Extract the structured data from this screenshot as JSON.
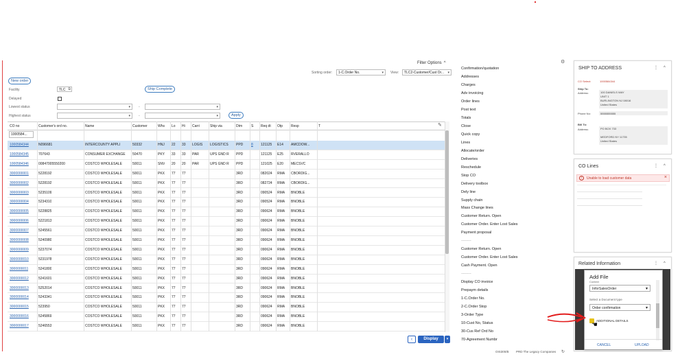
{
  "header": {
    "filter_options": "Filter Options",
    "sorting_order_label": "Sorting order:",
    "sorting_order_value": "1-C.Order No.",
    "view_label": "View:",
    "view_value": "TLC2-Customer/Cust Or..."
  },
  "filters": {
    "new_order": "New order",
    "facility_label": "Facility",
    "facility_value": "TLC",
    "ship_complete": "Ship Complete",
    "delayed_label": "Delayed",
    "lowest_status_label": "Lowest status",
    "highest_status_label": "Highest status",
    "dash": "-",
    "apply": "Apply",
    "co_filter_value": "1000584..."
  },
  "table": {
    "columns": [
      "CO no",
      "Customer's ord no.",
      "Name",
      "Customer",
      "Whs",
      "Lo",
      "Hi",
      "Carri",
      "Ship via",
      "Dtm",
      "S",
      "Req dt",
      "Otp",
      "Resp",
      "T"
    ],
    "rows": [
      [
        "1000584344",
        "N096681",
        "INTERCOUNTY APPLI",
        "50332",
        "HNJ",
        "22",
        "33",
        "LOGIS",
        "LOGISTICS",
        "PPD",
        "8",
        "121125",
        "E14",
        "AMCDOW..."
      ],
      [
        "1000584345",
        "707643",
        "CONSUMER EXCHANGE",
        "50470",
        "PKY",
        "33",
        "33",
        "PAR",
        "UPS GND R",
        "PPD",
        "",
        "121125",
        "E25",
        "RVERALLO"
      ],
      [
        "1000584346",
        "00847005550200",
        "COSTCO WHOLESALE",
        "50011",
        "SNV",
        "20",
        "20",
        "PAR",
        "UPS GND R",
        "PPD",
        "",
        "121025",
        "E20",
        "MECSVC"
      ],
      [
        "3000000001",
        "5228192",
        "COSTCO WHOLESALE",
        "50011",
        "PKX",
        "77",
        "77",
        "",
        "",
        "3RD",
        "",
        "082024",
        "RMA",
        "CBORDIG..."
      ],
      [
        "3000000002",
        "5228192",
        "COSTCO WHOLESALE",
        "50011",
        "PKX",
        "77",
        "77",
        "",
        "",
        "3RD",
        "",
        "082724",
        "RMA",
        "CBORDIG..."
      ],
      [
        "3000000003",
        "5235109",
        "COSTCO WHOLESALE",
        "50011",
        "PKX",
        "77",
        "77",
        "",
        "",
        "3RD",
        "",
        "090524",
        "RMA",
        "BNOBLE"
      ],
      [
        "3000000004",
        "5234310",
        "COSTCO WHOLESALE",
        "50011",
        "PKX",
        "77",
        "77",
        "",
        "",
        "3RD",
        "",
        "090524",
        "RMA",
        "BNOBLE"
      ],
      [
        "3000000005",
        "5228825",
        "COSTCO WHOLESALE",
        "50011",
        "PKX",
        "77",
        "77",
        "",
        "",
        "3RD",
        "",
        "090624",
        "RMA",
        "BNOBLE"
      ],
      [
        "3000000006",
        "5221813",
        "COSTCO WHOLESALE",
        "50011",
        "PKX",
        "77",
        "77",
        "",
        "",
        "3RD",
        "",
        "090624",
        "RMA",
        "BNOBLE"
      ],
      [
        "3000000007",
        "5245561",
        "COSTCO WHOLESALE",
        "50011",
        "PKX",
        "77",
        "77",
        "",
        "",
        "3RD",
        "",
        "090624",
        "RMA",
        "BNOBLE"
      ],
      [
        "3000000008",
        "5240980",
        "COSTCO WHOLESALE",
        "50011",
        "PKX",
        "77",
        "77",
        "",
        "",
        "3RD",
        "",
        "090624",
        "RMA",
        "BNOBLE"
      ],
      [
        "3000000009",
        "5237074",
        "COSTCO WHOLESALE",
        "50011",
        "PKX",
        "77",
        "77",
        "",
        "",
        "3RD",
        "",
        "090624",
        "RMA",
        "BNOBLE"
      ],
      [
        "3000000010",
        "5231978",
        "COSTCO WHOLESALE",
        "50011",
        "PKX",
        "77",
        "77",
        "",
        "",
        "3RD",
        "",
        "090624",
        "RMA",
        "BNOBLE"
      ],
      [
        "3000000011",
        "5241800",
        "COSTCO WHOLESALE",
        "50011",
        "PKX",
        "77",
        "77",
        "",
        "",
        "3RD",
        "",
        "090624",
        "RMA",
        "BNOBLE"
      ],
      [
        "3000000012",
        "5241601",
        "COSTCO WHOLESALE",
        "50011",
        "PKX",
        "77",
        "77",
        "",
        "",
        "3RD",
        "",
        "090624",
        "RMA",
        "BNOBLE"
      ],
      [
        "3000000013",
        "5252014",
        "COSTCO WHOLESALE",
        "50011",
        "PKX",
        "77",
        "77",
        "",
        "",
        "3RD",
        "",
        "090624",
        "RMA",
        "BNOBLE"
      ],
      [
        "3000000014",
        "5243341",
        "COSTCO WHOLESALE",
        "50011",
        "PKX",
        "77",
        "77",
        "",
        "",
        "3RD",
        "",
        "090624",
        "RMA",
        "BNOBLE"
      ],
      [
        "3000000015",
        "523950",
        "COSTCO WHOLESALE",
        "50011",
        "PKX",
        "77",
        "77",
        "",
        "",
        "3RD",
        "",
        "090624",
        "RMA",
        "BNOBLE"
      ],
      [
        "3000000016",
        "5245869",
        "COSTCO WHOLESALE",
        "50011",
        "PKX",
        "77",
        "77",
        "",
        "",
        "3RD",
        "",
        "090624",
        "RMA",
        "BNOBLE"
      ],
      [
        "3000000017",
        "5246553",
        "COSTCO WHOLESALE",
        "50011",
        "PKX",
        "77",
        "77",
        "",
        "",
        "3RD",
        "",
        "090624",
        "RMA",
        "BNOBLE"
      ]
    ],
    "display": "Display",
    "back": "‹",
    "dropdown": "▾"
  },
  "menu": [
    "Confirmation/quotation",
    "Addresses",
    "Charges",
    "Adv invoicing",
    "Order lines",
    "Post text",
    "Totals",
    "Close",
    "Quick copy",
    "Lines",
    "Allocate/order",
    "Deliveries",
    "Reschedule",
    "Stop CO",
    "Delivery toolbox",
    "Dely line",
    "Supply chain",
    "Mass Change lines",
    "Customer Return. Open",
    "Customer Order. Enter Lost Sales",
    "Payment proposal",
    "--------",
    "Customer Return. Open",
    "Customer Order. Enter Lost Sales",
    "Cash Payment. Open",
    "--------",
    "Display CO invoice",
    "Prepaym details",
    "1-C.Order No.",
    "2-C.Order Stop",
    "3-Order Type",
    "10-Cust No, Status",
    "30-Cus Ref Ord No",
    "70-Agreement Numbr"
  ],
  "ship_to": {
    "title": "SHIP TO ADDRESS",
    "co_select_label": "CO Select:",
    "co_select_value": "1000584344",
    "ship_to_label": "Ship To:",
    "address_label": "Address:",
    "address_lines": [
      "100 DANIELS WAY",
      "UNIT 1",
      "BURLINGTON NJ 08016",
      "United States"
    ],
    "phone_label": "Phone No:",
    "phone_value": "5555555555",
    "bill_to_label": "Bill To:",
    "bill_address_label": "Address:",
    "bill_lines": [
      "PO BOX 733",
      "",
      "MEDFORD NY 11735",
      "United States"
    ]
  },
  "co_lines": {
    "title": "CO Lines",
    "error": "Unable to load customer data"
  },
  "related": {
    "title": "Related Information",
    "modal_title": "Add File",
    "context_label": "Context",
    "context_value": "InforSalesOrder",
    "doc_type_label": "Select a Document type",
    "doc_type_value": "Order confirmation",
    "additional_details": "ADDITIONAL DETAILS",
    "cancel": "CANCEL",
    "upload": "UPLOAD"
  },
  "footer": {
    "program": "OIS300/B",
    "company": "PRD The Legacy Companies"
  },
  "icons": {
    "panel_menu": "⋮",
    "collapse": "^",
    "close": "×",
    "error": "!",
    "gear": "⚙",
    "calendar": "▣"
  },
  "colors": {
    "accent": "#2a64c0",
    "link": "#2a64b0",
    "selected_row": "#cfe2f5",
    "error_text": "#c0392b",
    "arrow": "#e21b1b"
  }
}
